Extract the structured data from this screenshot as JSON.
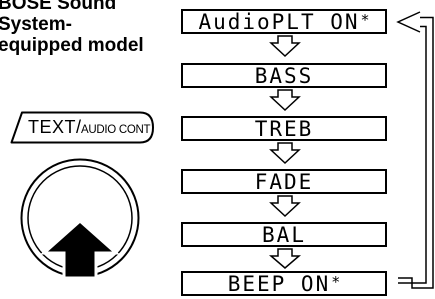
{
  "model_label": {
    "line1": "BOSE Sound",
    "line2": "System-",
    "line3": "equipped model"
  },
  "button": {
    "main": "TEXT",
    "separator": "/",
    "sub": "AUDIO CONT"
  },
  "menu": {
    "items": [
      {
        "label": "AudioPLT ON",
        "marker": "*"
      },
      {
        "label": "BASS",
        "marker": ""
      },
      {
        "label": "TREB",
        "marker": ""
      },
      {
        "label": "FADE",
        "marker": ""
      },
      {
        "label": "BAL",
        "marker": ""
      },
      {
        "label": "BEEP ON",
        "marker": "*"
      }
    ]
  }
}
